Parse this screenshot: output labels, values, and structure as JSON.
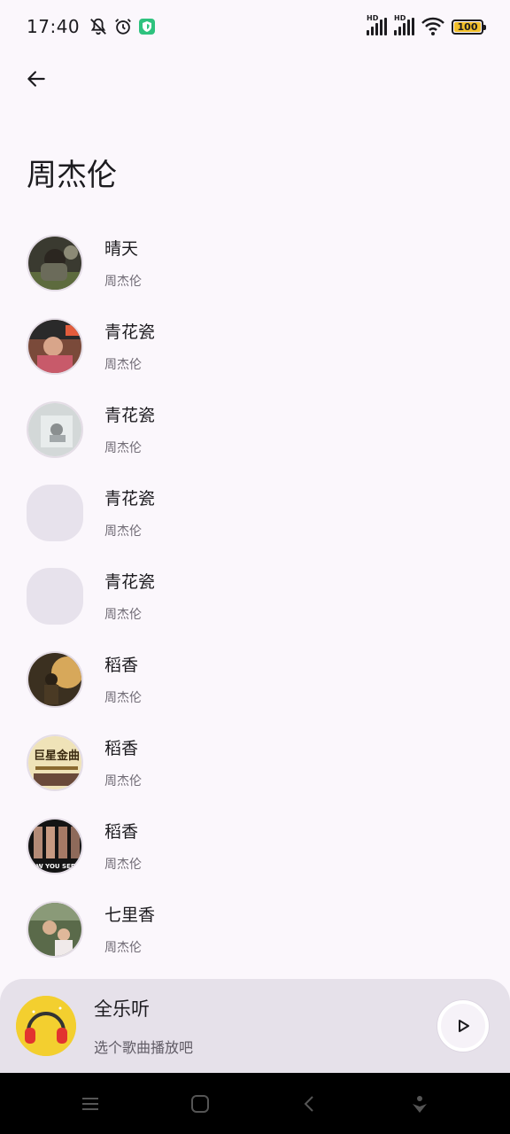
{
  "status_bar": {
    "time": "17:40",
    "battery": "100"
  },
  "page": {
    "title": "周杰伦"
  },
  "songs": [
    {
      "title": "晴天",
      "artist": "周杰伦"
    },
    {
      "title": "青花瓷",
      "artist": "周杰伦"
    },
    {
      "title": "青花瓷",
      "artist": "周杰伦"
    },
    {
      "title": "青花瓷",
      "artist": "周杰伦"
    },
    {
      "title": "青花瓷",
      "artist": "周杰伦"
    },
    {
      "title": "稻香",
      "artist": "周杰伦"
    },
    {
      "title": "稻香",
      "artist": "周杰伦"
    },
    {
      "title": "稻香",
      "artist": "周杰伦"
    },
    {
      "title": "七里香",
      "artist": "周杰伦"
    }
  ],
  "cover_texts": {
    "album7": "巨星金曲",
    "album8": "NOW YOU SEE ME"
  },
  "mini_player": {
    "title": "全乐听",
    "subtitle": "选个歌曲播放吧"
  },
  "colors": {
    "background": "#fbf7fc",
    "player_bg": "#e6e1ea",
    "battery": "#f2c02a"
  }
}
